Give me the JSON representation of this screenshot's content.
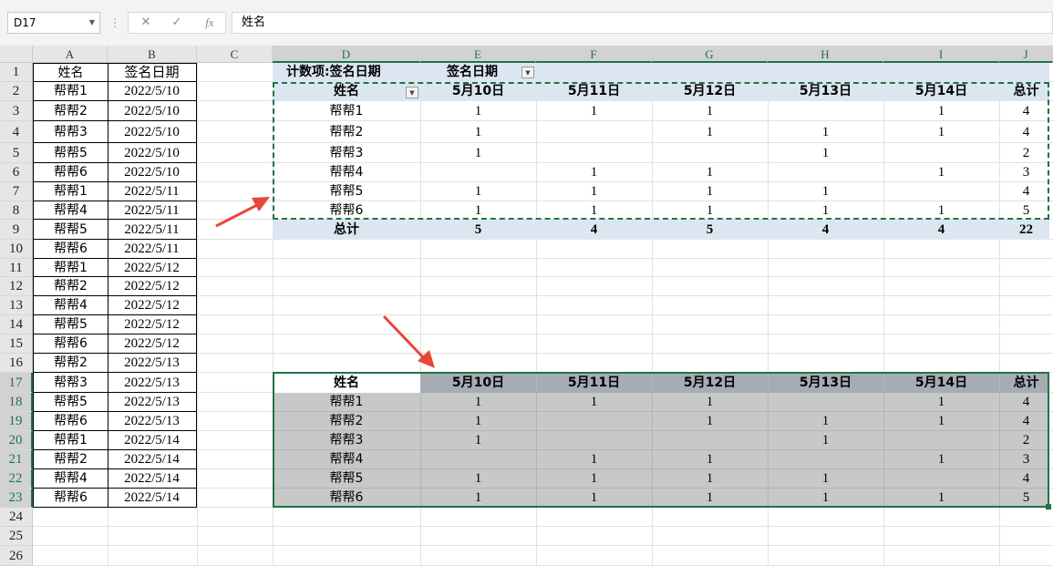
{
  "formula_bar": {
    "name_box": "D17",
    "formula": "姓名"
  },
  "columns": [
    "A",
    "B",
    "C",
    "D",
    "E",
    "F",
    "G",
    "H",
    "I",
    "J"
  ],
  "rows": [
    "1",
    "2",
    "3",
    "4",
    "5",
    "6",
    "7",
    "8",
    "9",
    "10",
    "11",
    "12",
    "13",
    "14",
    "15",
    "16",
    "17",
    "18",
    "19",
    "20",
    "21",
    "22",
    "23",
    "24",
    "25",
    "26"
  ],
  "source": {
    "headers": [
      "姓名",
      "签名日期"
    ],
    "records": [
      [
        "帮帮1",
        "2022/5/10"
      ],
      [
        "帮帮2",
        "2022/5/10"
      ],
      [
        "帮帮3",
        "2022/5/10"
      ],
      [
        "帮帮5",
        "2022/5/10"
      ],
      [
        "帮帮6",
        "2022/5/10"
      ],
      [
        "帮帮1",
        "2022/5/11"
      ],
      [
        "帮帮4",
        "2022/5/11"
      ],
      [
        "帮帮5",
        "2022/5/11"
      ],
      [
        "帮帮6",
        "2022/5/11"
      ],
      [
        "帮帮1",
        "2022/5/12"
      ],
      [
        "帮帮2",
        "2022/5/12"
      ],
      [
        "帮帮4",
        "2022/5/12"
      ],
      [
        "帮帮5",
        "2022/5/12"
      ],
      [
        "帮帮6",
        "2022/5/12"
      ],
      [
        "帮帮2",
        "2022/5/13"
      ],
      [
        "帮帮3",
        "2022/5/13"
      ],
      [
        "帮帮5",
        "2022/5/13"
      ],
      [
        "帮帮6",
        "2022/5/13"
      ],
      [
        "帮帮1",
        "2022/5/14"
      ],
      [
        "帮帮2",
        "2022/5/14"
      ],
      [
        "帮帮4",
        "2022/5/14"
      ],
      [
        "帮帮6",
        "2022/5/14"
      ]
    ]
  },
  "pivot": {
    "label_count": "计数项:签名日期",
    "label_field": "签名日期",
    "row_field": "姓名",
    "columns": [
      "5月10日",
      "5月11日",
      "5月12日",
      "5月13日",
      "5月14日",
      "总计"
    ],
    "rows": [
      {
        "name": "帮帮1",
        "values": [
          "1",
          "1",
          "1",
          "",
          "1",
          "4"
        ]
      },
      {
        "name": "帮帮2",
        "values": [
          "1",
          "",
          "1",
          "1",
          "1",
          "4"
        ]
      },
      {
        "name": "帮帮3",
        "values": [
          "1",
          "",
          "",
          "1",
          "",
          "2"
        ]
      },
      {
        "name": "帮帮4",
        "values": [
          "",
          "1",
          "1",
          "",
          "1",
          "3"
        ]
      },
      {
        "name": "帮帮5",
        "values": [
          "1",
          "1",
          "1",
          "1",
          "",
          "4"
        ]
      },
      {
        "name": "帮帮6",
        "values": [
          "1",
          "1",
          "1",
          "1",
          "1",
          "5"
        ]
      }
    ],
    "total": {
      "name": "总计",
      "values": [
        "5",
        "4",
        "5",
        "4",
        "4",
        "22"
      ]
    }
  },
  "copy": {
    "header_name": "姓名",
    "columns": [
      "5月10日",
      "5月11日",
      "5月12日",
      "5月13日",
      "5月14日",
      "总计"
    ],
    "rows": [
      {
        "name": "帮帮1",
        "values": [
          "1",
          "1",
          "1",
          "",
          "1",
          "4"
        ]
      },
      {
        "name": "帮帮2",
        "values": [
          "1",
          "",
          "1",
          "1",
          "1",
          "4"
        ]
      },
      {
        "name": "帮帮3",
        "values": [
          "1",
          "",
          "",
          "1",
          "",
          "2"
        ]
      },
      {
        "name": "帮帮4",
        "values": [
          "",
          "1",
          "1",
          "",
          "1",
          "3"
        ]
      },
      {
        "name": "帮帮5",
        "values": [
          "1",
          "1",
          "1",
          "1",
          "",
          "4"
        ]
      },
      {
        "name": "帮帮6",
        "values": [
          "1",
          "1",
          "1",
          "1",
          "1",
          "5"
        ]
      }
    ]
  },
  "colors": {
    "accent": "#217346",
    "arrow": "#e8463c",
    "pivot_band": "#dce6f1",
    "copy_fill": "#c8c8c8",
    "copy_header": "#a6acb4"
  }
}
